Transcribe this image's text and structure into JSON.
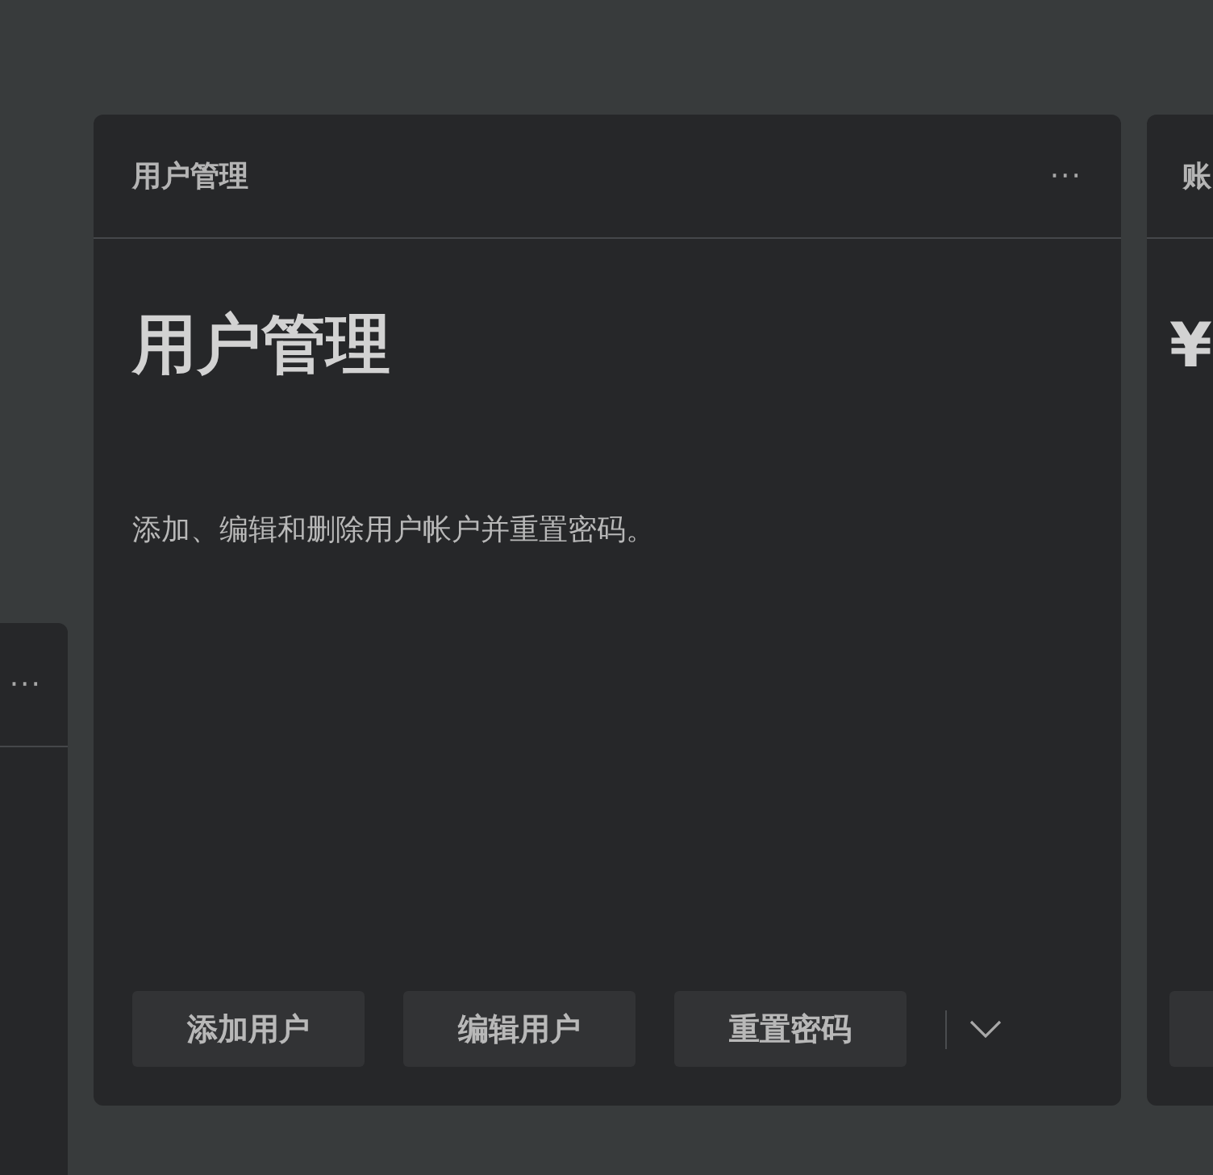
{
  "cards": [
    {
      "kind": "partial-left",
      "menu_icon": "···"
    },
    {
      "kind": "main",
      "header": "用户管理",
      "menu_icon": "···",
      "title": "用户管理",
      "description": "添加、编辑和删除用户帐户并重置密码。",
      "actions": [
        "添加用户",
        "编辑用户",
        "重置密码"
      ]
    },
    {
      "kind": "partial-right",
      "header": "账",
      "title": "¥"
    }
  ]
}
